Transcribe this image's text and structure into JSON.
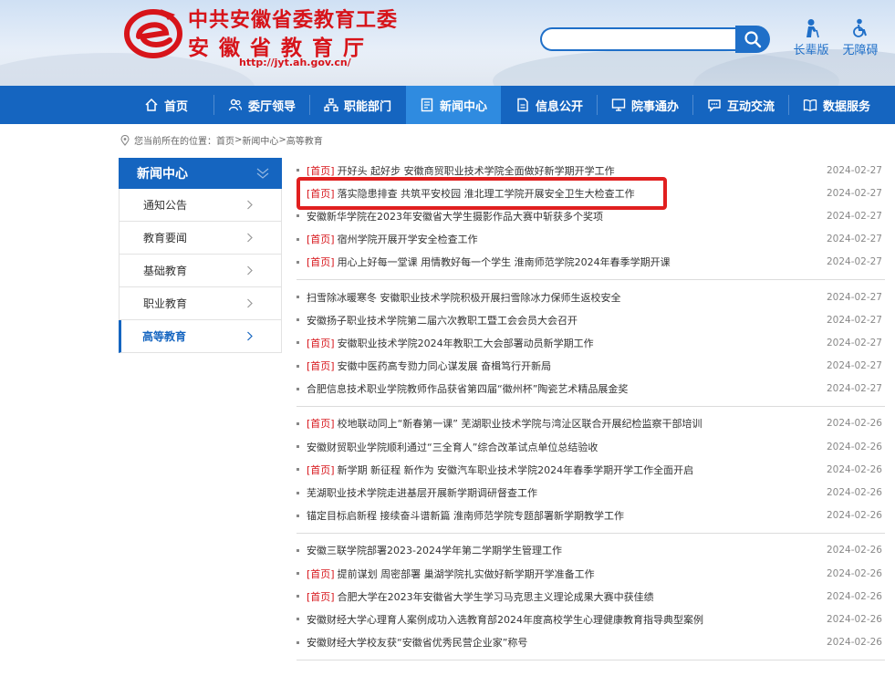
{
  "header": {
    "title_line1": "中共安徽省委教育工委",
    "title_line2": "安徽省教育厅",
    "url": "http://jyt.ah.gov.cn/",
    "search": {
      "placeholder": ""
    },
    "accessibility": [
      {
        "label": "长辈版",
        "icon": "elder-icon"
      },
      {
        "label": "无障碍",
        "icon": "wheelchair-icon"
      }
    ],
    "brand_red": "#d7141a"
  },
  "nav": {
    "items": [
      {
        "label": "首页",
        "icon": "home-icon"
      },
      {
        "label": "委厅领导",
        "icon": "people-icon"
      },
      {
        "label": "职能部门",
        "icon": "org-icon"
      },
      {
        "label": "新闻中心",
        "icon": "news-icon",
        "active": true
      },
      {
        "label": "信息公开",
        "icon": "document-icon"
      },
      {
        "label": "院事通办",
        "icon": "monitor-icon"
      },
      {
        "label": "互动交流",
        "icon": "chat-icon"
      },
      {
        "label": "数据服务",
        "icon": "book-icon"
      }
    ],
    "color": "#1565c0",
    "active_color": "#2f8be0"
  },
  "breadcrumb": {
    "prefix": "您当前所在的位置：",
    "items": [
      "首页",
      "新闻中心",
      "高等教育"
    ],
    "separator": " > "
  },
  "sidebar": {
    "title": "新闻中心",
    "items": [
      {
        "label": "通知公告"
      },
      {
        "label": "教育要闻"
      },
      {
        "label": "基础教育"
      },
      {
        "label": "职业教育"
      },
      {
        "label": "高等教育",
        "active": true
      }
    ]
  },
  "news": {
    "tag_label": "[首页]",
    "groups": [
      [
        {
          "tag": true,
          "title": "开好头 起好步 安徽商贸职业技术学院全面做好新学期开学工作",
          "date": "2024-02-27"
        },
        {
          "tag": true,
          "title": "落实隐患排查 共筑平安校园 淮北理工学院开展安全卫生大检查工作",
          "date": "2024-02-27",
          "highlighted": true
        },
        {
          "tag": false,
          "title": "安徽新华学院在2023年安徽省大学生摄影作品大赛中斩获多个奖项",
          "date": "2024-02-27"
        },
        {
          "tag": true,
          "title": "宿州学院开展开学安全检查工作",
          "date": "2024-02-27"
        },
        {
          "tag": true,
          "title": "用心上好每一堂课 用情教好每一个学生 淮南师范学院2024年春季学期开课",
          "date": "2024-02-27"
        }
      ],
      [
        {
          "tag": false,
          "title": "扫雪除冰暖寒冬 安徽职业技术学院积极开展扫雪除冰力保师生返校安全",
          "date": "2024-02-27"
        },
        {
          "tag": false,
          "title": "安徽扬子职业技术学院第二届六次教职工暨工会会员大会召开",
          "date": "2024-02-27"
        },
        {
          "tag": true,
          "title": "安徽职业技术学院2024年教职工大会部署动员新学期工作",
          "date": "2024-02-27"
        },
        {
          "tag": true,
          "title": "安徽中医药高专勠力同心谋发展 奋楫笃行开新局",
          "date": "2024-02-27"
        },
        {
          "tag": false,
          "title": "合肥信息技术职业学院教师作品获省第四届“徽州杯”陶瓷艺术精品展金奖",
          "date": "2024-02-27"
        }
      ],
      [
        {
          "tag": true,
          "title": "校地联动同上“新春第一课” 芜湖职业技术学院与湾沚区联合开展纪检监察干部培训",
          "date": "2024-02-26"
        },
        {
          "tag": false,
          "title": "安徽财贸职业学院顺利通过“三全育人”综合改革试点单位总结验收",
          "date": "2024-02-26"
        },
        {
          "tag": true,
          "title": "新学期 新征程 新作为 安徽汽车职业技术学院2024年春季学期开学工作全面开启",
          "date": "2024-02-26"
        },
        {
          "tag": false,
          "title": "芜湖职业技术学院走进基层开展新学期调研督查工作",
          "date": "2024-02-26"
        },
        {
          "tag": false,
          "title": "锚定目标启新程 接续奋斗谱新篇 淮南师范学院专题部署新学期教学工作",
          "date": "2024-02-26"
        }
      ],
      [
        {
          "tag": false,
          "title": "安徽三联学院部署2023-2024学年第二学期学生管理工作",
          "date": "2024-02-26"
        },
        {
          "tag": true,
          "title": "提前谋划 周密部署 巢湖学院扎实做好新学期开学准备工作",
          "date": "2024-02-26"
        },
        {
          "tag": true,
          "title": "合肥大学在2023年安徽省大学生学习马克思主义理论成果大赛中获佳绩",
          "date": "2024-02-26"
        },
        {
          "tag": false,
          "title": "安徽财经大学心理育人案例成功入选教育部2024年度高校学生心理健康教育指导典型案例",
          "date": "2024-02-26"
        },
        {
          "tag": false,
          "title": "安徽财经大学校友获“安徽省优秀民营企业家”称号",
          "date": "2024-02-26"
        }
      ]
    ]
  }
}
